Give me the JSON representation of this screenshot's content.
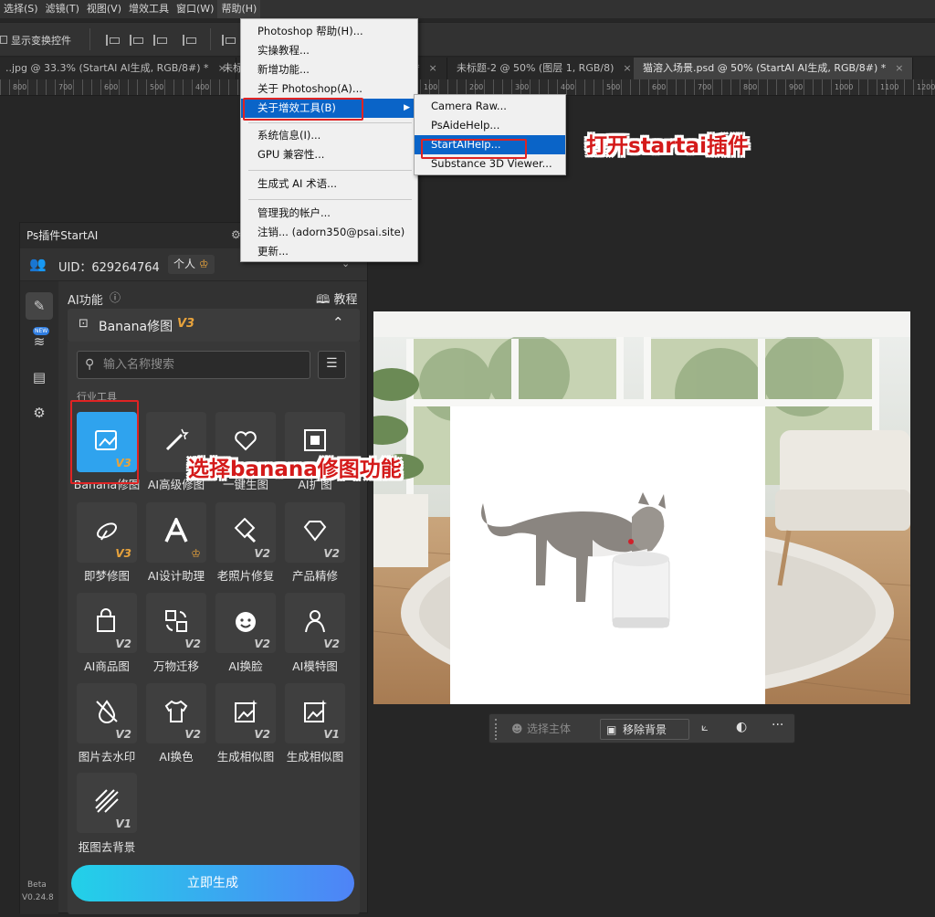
{
  "menubar": {
    "items": [
      "选择(S)",
      "滤镜(T)",
      "视图(V)",
      "增效工具",
      "窗口(W)",
      "帮助(H)"
    ]
  },
  "options_bar": {
    "show_transform": "显示变换控件"
  },
  "tabs": [
    {
      "label": "..jpg @ 33.3% (StartAI AI生成, RGB/8#) *"
    },
    {
      "label": "未标"
    },
    {
      "label": "*"
    },
    {
      "label": "未标题-2 @ 50% (图层 1, RGB/8)"
    },
    {
      "label": "猫溶入场景.psd @ 50% (StartAI AI生成, RGB/8#) *"
    }
  ],
  "ruler": {
    "ticks": [
      "800",
      "700",
      "600",
      "500",
      "400",
      "300",
      "200",
      "100",
      "0",
      "100",
      "200",
      "300",
      "400",
      "500",
      "600",
      "700",
      "800",
      "900",
      "1000",
      "1100",
      "1200"
    ]
  },
  "help_menu": {
    "items": [
      "Photoshop 帮助(H)...",
      "实操教程...",
      "新增功能...",
      "关于 Photoshop(A)...",
      "关于增效工具(B)",
      "系统信息(I)...",
      "GPU 兼容性...",
      "生成式 AI 术语...",
      "管理我的帐户...",
      "注销... (adorn350@psai.site)",
      "更新..."
    ]
  },
  "submenu": {
    "items": [
      "Camera Raw...",
      "PsAideHelp...",
      "StartAIHelp...",
      "Substance 3D Viewer..."
    ]
  },
  "panel": {
    "title": "Ps插件StartAI",
    "uid": "UID：629264764",
    "account_type": "个人",
    "section_label": "AI功能",
    "tutorial": "教程",
    "banana_section": "Banana修图",
    "banana_version": "V3",
    "search_placeholder": "输入名称搜索",
    "group_label": "行业工具",
    "tools": [
      {
        "label": "Banana修图",
        "version": "V3"
      },
      {
        "label": "AI高级修图",
        "version": ""
      },
      {
        "label": "一键生图",
        "version": ""
      },
      {
        "label": "AI扩图",
        "version": ""
      },
      {
        "label": "即梦修图",
        "version": "V3"
      },
      {
        "label": "AI设计助理",
        "version": ""
      },
      {
        "label": "老照片修复",
        "version": "V2"
      },
      {
        "label": "产品精修",
        "version": "V2"
      },
      {
        "label": "AI商品图",
        "version": "V2"
      },
      {
        "label": "万物迁移",
        "version": "V2"
      },
      {
        "label": "AI换脸",
        "version": "V2"
      },
      {
        "label": "AI模特图",
        "version": "V2"
      },
      {
        "label": "图片去水印",
        "version": "V2"
      },
      {
        "label": "AI换色",
        "version": "V2"
      },
      {
        "label": "生成相似图",
        "version": "V2"
      },
      {
        "label": "生成相似图",
        "version": "V1"
      },
      {
        "label": "抠图去背景",
        "version": "V1"
      }
    ],
    "generate_button": "立即生成",
    "beta": "Beta",
    "version": "V0.24.8",
    "new_badge": "NEW"
  },
  "context_bar": {
    "select_subject": "选择主体",
    "remove_bg": "移除背景"
  },
  "annotations": {
    "open_plugin": "打开startai插件",
    "choose_banana": "选择banana修图功能"
  },
  "colors": {
    "accent_blue": "#0a64c8",
    "tile_active": "#2fa3ee",
    "callout_red": "#d41a1a",
    "gold": "#e8a33c"
  }
}
